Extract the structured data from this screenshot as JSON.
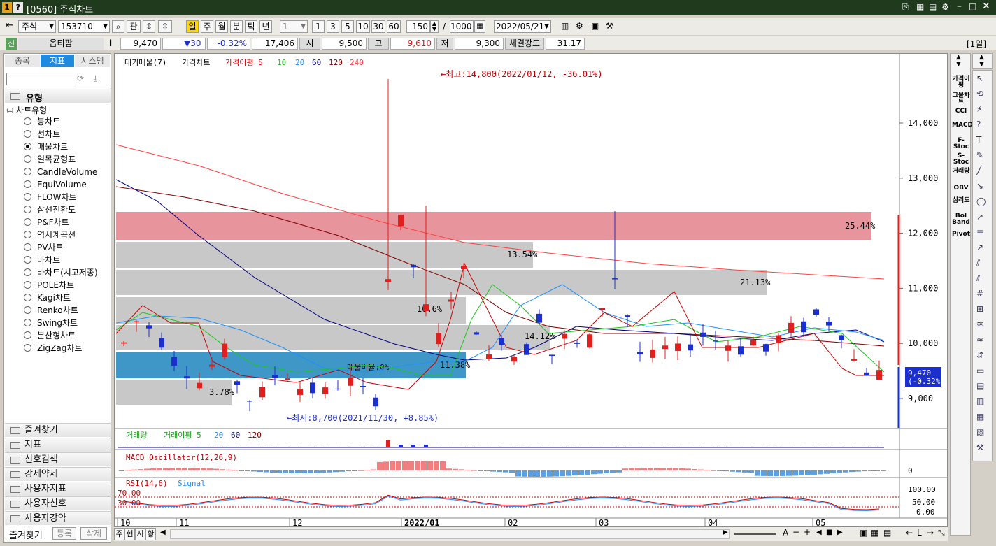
{
  "window": {
    "title": "[0560] 주식차트",
    "icon_a": "1",
    "icon_b": "?"
  },
  "toolbar": {
    "market": "주식",
    "code": "153710",
    "gwan": "관",
    "period_buttons": [
      "일",
      "주",
      "월",
      "분",
      "틱",
      "년"
    ],
    "interval_value": "1",
    "num_buttons": [
      "1",
      "3",
      "5",
      "10",
      "30",
      "60"
    ],
    "count": "150",
    "slash": "/",
    "max": "1000",
    "date": "2022/05/21"
  },
  "quote": {
    "badge": "신",
    "name": "옵티팜",
    "info_icon": "i",
    "price": "9,470",
    "change": "▼30",
    "change_pct": "-0.32%",
    "volume": "17,406",
    "open_label": "시",
    "open": "9,500",
    "high_label": "고",
    "high": "9,610",
    "low_label": "저",
    "low": "9,300",
    "strength_label": "체결강도",
    "strength": "31.17",
    "period_tag": "[1일]"
  },
  "left_panel": {
    "tabs": [
      "종목",
      "지표",
      "시스템"
    ],
    "section_title": "유형",
    "tree_root": "차트유형",
    "chart_types": [
      "봉차트",
      "선차트",
      "매물차트",
      "일목균형표",
      "CandleVolume",
      "EquiVolume",
      "FLOW차트",
      "삼선전환도",
      "P&F차트",
      "역시계곡선",
      "PV차트",
      "바차트",
      "바차트(시고저종)",
      "POLE차트",
      "Kagi차트",
      "Renko차트",
      "Swing차트",
      "분산형차트",
      "ZigZag차트"
    ],
    "selected_index": 2,
    "menu": [
      "즐겨찾기",
      "지표",
      "신호검색",
      "강세약세",
      "사용자지표",
      "사용자신호",
      "사용자강약"
    ],
    "footer": [
      "즐겨찾기",
      "등록",
      "삭제"
    ]
  },
  "chart": {
    "legend": [
      "대기매물(7)",
      "가격차트",
      "가격이평 5",
      "10",
      "20",
      "60",
      "120",
      "240"
    ],
    "legend_colors": [
      "#000000",
      "#000000",
      "#cc0000",
      "#19c819",
      "#1e90ff",
      "#1e90ff",
      "#000080",
      "#800000",
      "#ff4040"
    ],
    "y_ticks": [
      "14,000",
      "13,000",
      "12,000",
      "11,000",
      "10,000",
      "9,000"
    ],
    "x_ticks": [
      "10",
      "11",
      "12",
      "2022/01",
      "02",
      "03",
      "04",
      "05"
    ],
    "max_note": "←최고:14,800(2022/01/12, -36.01%)",
    "min_note": "←최저:8,700(2021/11/30, +8.85%)",
    "bands": [
      {
        "label": "25.44%",
        "color": "#e8949c"
      },
      {
        "label": "13.54%",
        "color": "#c8c8c8"
      },
      {
        "label": "21.13%",
        "color": "#c8c8c8"
      },
      {
        "label": "10.6%",
        "color": "#c8c8c8"
      },
      {
        "label": "14.12%",
        "color": "#c8c8c8"
      },
      {
        "label": "11.38%",
        "color": "#3f97c8"
      },
      {
        "label": "3.78%",
        "color": "#c8c8c8"
      }
    ],
    "band_note": "매물비율:0%",
    "price_tag": "9,470",
    "price_tag_pct": "(-0.32%)",
    "volume_legend": [
      "거래량",
      "거래이평 5",
      "20",
      "60",
      "120"
    ],
    "macd_legend": "MACD Oscillator(12,26,9)",
    "macd_zero": "0",
    "rsi_legend": [
      "RSI(14,6)",
      "Signal"
    ],
    "rsi_levels": [
      "70.00",
      "30.00"
    ],
    "rsi_ticks": [
      "100.00",
      "50.00",
      "0.00"
    ]
  },
  "bottom": {
    "buttons": [
      "주",
      "현",
      "시",
      "황"
    ]
  },
  "right_indicators": [
    "가격이평",
    "그물차트",
    "CCI",
    "MACD",
    "F-Stoc",
    "S-Stoc",
    "거래량",
    "OBV",
    "심리도",
    "Bol Band",
    "Pivot"
  ],
  "colors": {
    "up": "#e0201c",
    "down": "#1a2fcc",
    "titlebar": "#1f3a1d",
    "accent": "#1e8be0"
  }
}
